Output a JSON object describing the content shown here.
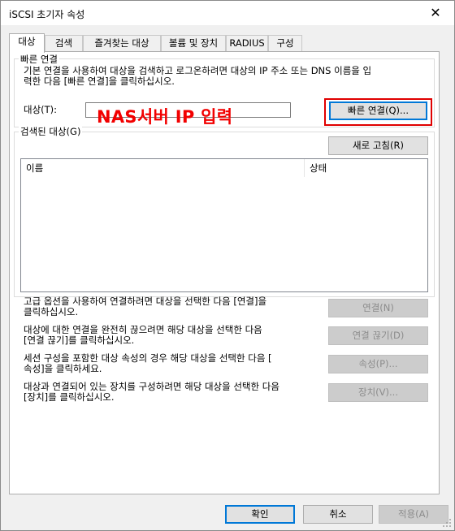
{
  "window": {
    "title": "iSCSI 초기자 속성"
  },
  "tabs": [
    {
      "label": "대상"
    },
    {
      "label": "검색"
    },
    {
      "label": "즐겨찾는 대상"
    },
    {
      "label": "볼륨 및 장치"
    },
    {
      "label": "RADIUS"
    },
    {
      "label": "구성"
    }
  ],
  "quick_connect": {
    "legend": "빠른 연결",
    "description_line1": "기본 연결을 사용하여 대상을 검색하고 로그온하려면 대상의 IP 주소 또는 DNS 이름을 입",
    "description_line2": "력한 다음 [빠른 연결]을 클릭하십시오.",
    "target_label": "대상(T):",
    "target_value": "",
    "button_label": "빠른 연결(Q)..."
  },
  "annotation": {
    "text": "NAS서버 IP 입력",
    "color": "#f20000"
  },
  "discovered": {
    "legend": "검색된 대상(G)",
    "refresh_button": "새로 고침(R)",
    "columns": [
      "이름",
      "상태"
    ],
    "rows": []
  },
  "actions": [
    {
      "line1": "고급 옵션을 사용하여 연결하려면 대상을 선택한 다음 [연결]을",
      "line2": "클릭하십시오.",
      "button": "연결(N)"
    },
    {
      "line1": "대상에 대한 연결을 완전히 끊으려면 해당 대상을 선택한 다음",
      "line2": "[연결 끊기]를 클릭하십시오.",
      "button": "연결 끊기(D)"
    },
    {
      "line1": "세션 구성을 포함한 대상 속성의 경우 해당 대상을 선택한 다음 [",
      "line2": "속성]을 클릭하세요.",
      "button": "속성(P)..."
    },
    {
      "line1": "대상과 연결되어 있는 장치를 구성하려면 해당 대상을 선택한 다음",
      "line2": "[장치]를 클릭하십시오.",
      "button": "장치(V)..."
    }
  ],
  "footer": {
    "ok": "확인",
    "cancel": "취소",
    "apply": "적용(A)"
  }
}
